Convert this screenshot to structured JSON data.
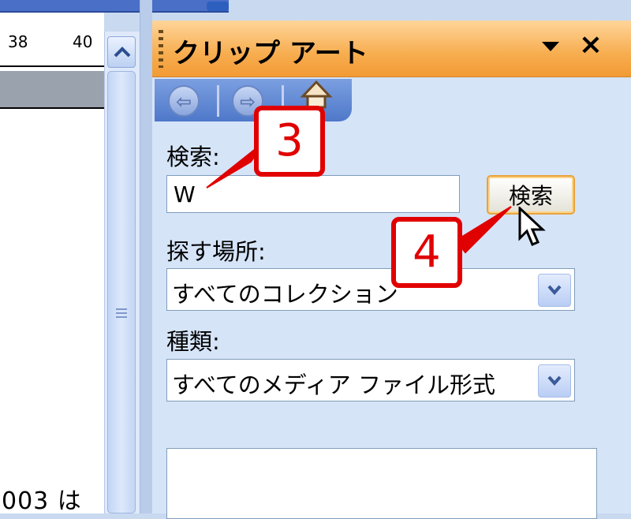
{
  "document": {
    "ruler_numbers": [
      "38",
      "40"
    ],
    "text_fragment": "003 は"
  },
  "task_pane": {
    "title": "クリップ アート",
    "nav": {
      "back_icon": "back-arrow-icon",
      "forward_icon": "forward-arrow-icon",
      "home_icon": "home-icon"
    },
    "search": {
      "label": "検索:",
      "value": "W",
      "button_label": "検索"
    },
    "location": {
      "label": "探す場所:",
      "selected": "すべてのコレクション"
    },
    "media_type": {
      "label": "種類:",
      "selected": "すべてのメディア ファイル形式"
    }
  },
  "callouts": [
    "3",
    "4"
  ],
  "colors": {
    "titlebar": "#f7ad4f",
    "callout_red": "#e10000",
    "pane_bg": "#d6e4f8",
    "nav_blue": "#4e78c9"
  }
}
